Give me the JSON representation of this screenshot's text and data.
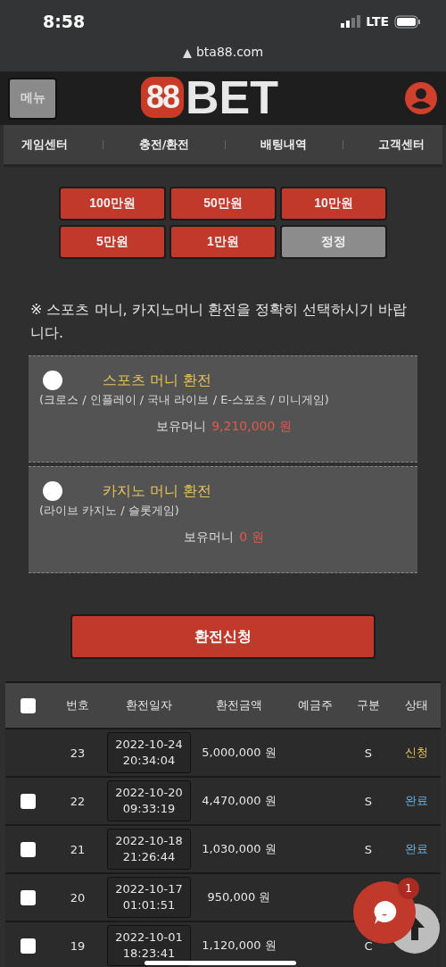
{
  "status_bar": {
    "time": "8:58",
    "network": "LTE"
  },
  "browser": {
    "url": "bta88.com"
  },
  "header": {
    "menu_button": "메뉴",
    "logo_number": "88",
    "logo_text": "BET"
  },
  "nav": [
    "게임센터",
    "충전/환전",
    "배팅내역",
    "고객센터"
  ],
  "amount_buttons": [
    {
      "label": "100만원",
      "kind": "amount"
    },
    {
      "label": "50만원",
      "kind": "amount"
    },
    {
      "label": "10만원",
      "kind": "amount"
    },
    {
      "label": "5만원",
      "kind": "amount"
    },
    {
      "label": "1만원",
      "kind": "amount"
    },
    {
      "label": "정정",
      "kind": "reset"
    }
  ],
  "notice": "※ 스포츠 머니, 카지노머니 환전을 정확히 선택하시기 바랍니다.",
  "options": [
    {
      "title": "스포츠 머니 환전",
      "subtitle": "(크로스 / 인플레이 / 국내 라이브 / E-스포츠 / 미니게임)",
      "balance_label": "보유머니",
      "balance": "9,210,000 원",
      "selected": false
    },
    {
      "title": "카지노 머니 환전",
      "subtitle": "(라이브 카지노 / 슬롯게임)",
      "balance_label": "보유머니",
      "balance": "0 원",
      "selected": false
    }
  ],
  "submit_button": "환전신청",
  "table": {
    "select_all_checked": false,
    "columns": [
      "번호",
      "환전일자",
      "환전금액",
      "예금주",
      "구분",
      "상태"
    ],
    "rows": [
      {
        "number": "23",
        "date": "2022-10-24",
        "time": "20:34:04",
        "amount": "5,000,000 원",
        "type": "S",
        "status": "신청",
        "kind": "pending"
      },
      {
        "checked": false,
        "number": "22",
        "date": "2022-10-20",
        "time": "09:33:19",
        "amount": "4,470,000 원",
        "type": "S",
        "status": "완료",
        "kind": "complete"
      },
      {
        "checked": false,
        "number": "21",
        "date": "2022-10-18",
        "time": "21:26:44",
        "amount": "1,030,000 원",
        "type": "S",
        "status": "완료",
        "kind": "complete"
      },
      {
        "checked": false,
        "number": "20",
        "date": "2022-10-17",
        "time": "01:01:51",
        "amount": "950,000 원"
      },
      {
        "checked": false,
        "number": "19",
        "date": "2022-10-01",
        "time": "18:23:41",
        "amount": "1,120,000 원",
        "type": "C"
      }
    ]
  },
  "chat": {
    "badge": "1"
  }
}
